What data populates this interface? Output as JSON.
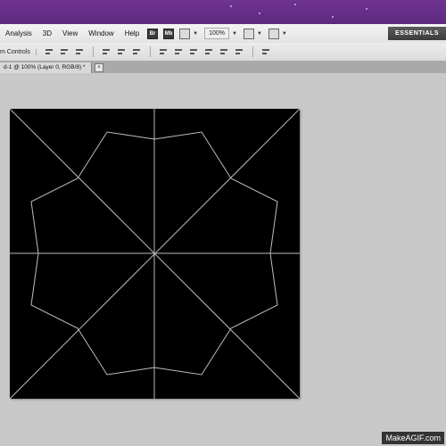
{
  "menubar": {
    "items": [
      "Analysis",
      "3D",
      "View",
      "Window",
      "Help"
    ],
    "icons": [
      "br-icon",
      "mb-icon",
      "screen-mode-icon",
      "arrange-icon",
      "extras-icon"
    ],
    "zoom": "100%",
    "workspace_button": "ESSENTIALS"
  },
  "optionsbar": {
    "label": "m Controls"
  },
  "tab": {
    "title": "d-1 @ 100% (Layer 0, RGB/8) *",
    "close": "×"
  },
  "watermark": "MakeAGIF.com"
}
